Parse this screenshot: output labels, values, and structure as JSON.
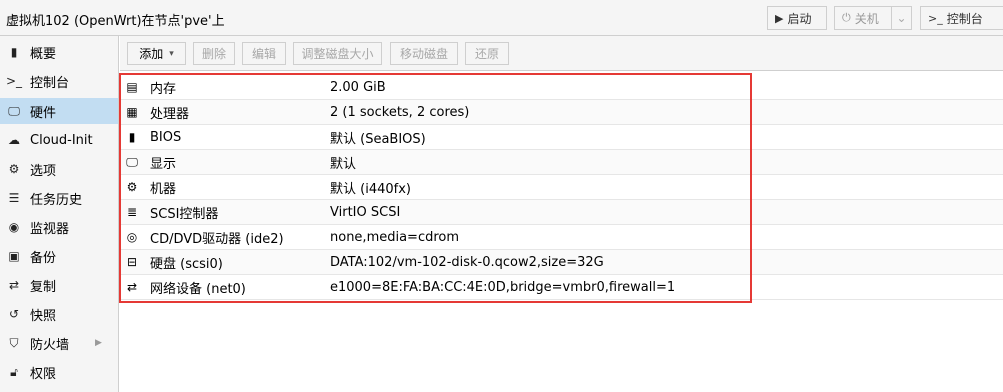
{
  "window": {
    "title": "虚拟机102 (OpenWrt)在节点'pve'上"
  },
  "header_buttons": {
    "start": "启动",
    "shutdown": "关机",
    "console": "控制台"
  },
  "sidebar": {
    "items": [
      {
        "label": "概要",
        "icon": "book-icon"
      },
      {
        "label": "控制台",
        "icon": "terminal-icon"
      },
      {
        "label": "硬件",
        "icon": "monitor-icon",
        "active": true
      },
      {
        "label": "Cloud-Init",
        "icon": "cloud-icon"
      },
      {
        "label": "选项",
        "icon": "gear-icon"
      },
      {
        "label": "任务历史",
        "icon": "list-icon"
      },
      {
        "label": "监视器",
        "icon": "eye-icon"
      },
      {
        "label": "备份",
        "icon": "floppy-icon"
      },
      {
        "label": "复制",
        "icon": "retweet-icon"
      },
      {
        "label": "快照",
        "icon": "history-icon"
      },
      {
        "label": "防火墙",
        "icon": "shield-icon"
      },
      {
        "label": "权限",
        "icon": "unlock-icon"
      }
    ]
  },
  "toolbar": {
    "add": "添加",
    "remove": "删除",
    "edit": "编辑",
    "resize": "调整磁盘大小",
    "move": "移动磁盘",
    "revert": "还原"
  },
  "hardware": [
    {
      "name": "内存",
      "value": "2.00 GiB",
      "icon": "memory-icon"
    },
    {
      "name": "处理器",
      "value": "2 (1 sockets, 2 cores)",
      "icon": "cpu-icon"
    },
    {
      "name": "BIOS",
      "value": "默认 (SeaBIOS)",
      "icon": "microchip-icon"
    },
    {
      "name": "显示",
      "value": "默认",
      "icon": "desktop-icon"
    },
    {
      "name": "机器",
      "value": "默认 (i440fx)",
      "icon": "cogs-icon"
    },
    {
      "name": "SCSI控制器",
      "value": "VirtIO SCSI",
      "icon": "database-icon"
    },
    {
      "name": "CD/DVD驱动器 (ide2)",
      "value": "none,media=cdrom",
      "icon": "cdrom-icon"
    },
    {
      "name": "硬盘 (scsi0)",
      "value": "DATA:102/vm-102-disk-0.qcow2,size=32G",
      "icon": "hdd-icon"
    },
    {
      "name": "网络设备 (net0)",
      "value": "e1000=8E:FA:BA:CC:4E:0D,bridge=vmbr0,firewall=1",
      "icon": "exchange-icon"
    }
  ],
  "colors": {
    "accent_active": "#c2ddf2",
    "highlight_border": "#e53935"
  }
}
